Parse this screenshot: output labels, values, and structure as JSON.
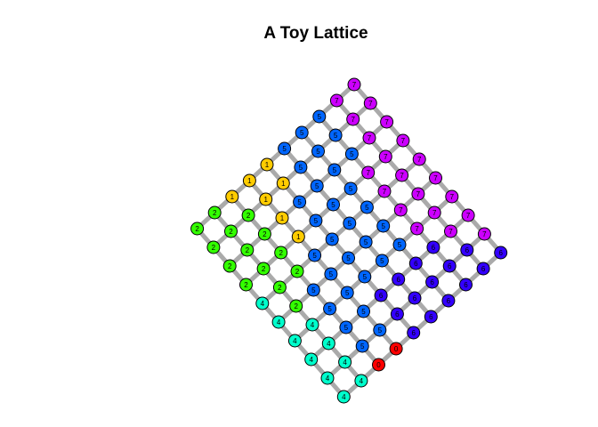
{
  "title": "A Toy Lattice",
  "colors": {
    "edge": "#aaaaaa",
    "node_stroke": "#000000",
    "groups": {
      "0": "#ff0000",
      "1": "#ffcc00",
      "2": "#33ff00",
      "3": "#00ff66",
      "4": "#00ffcc",
      "5": "#0066ff",
      "6": "#3300ff",
      "7": "#cc00ff"
    }
  },
  "lattice": {
    "rows": 10,
    "cols": 10,
    "groups": [
      [
        7,
        7,
        7,
        7,
        7,
        7,
        7,
        7,
        7,
        6
      ],
      [
        7,
        7,
        7,
        7,
        7,
        7,
        7,
        7,
        6,
        6
      ],
      [
        5,
        5,
        5,
        7,
        7,
        7,
        7,
        6,
        6,
        6
      ],
      [
        5,
        5,
        5,
        5,
        5,
        5,
        5,
        6,
        6,
        6
      ],
      [
        5,
        5,
        5,
        5,
        5,
        5,
        5,
        6,
        6,
        6
      ],
      [
        1,
        1,
        5,
        5,
        5,
        5,
        5,
        6,
        6,
        6
      ],
      [
        1,
        1,
        1,
        1,
        5,
        5,
        5,
        5,
        5,
        0
      ],
      [
        1,
        2,
        2,
        2,
        2,
        5,
        5,
        5,
        5,
        0
      ],
      [
        2,
        2,
        2,
        2,
        2,
        2,
        4,
        4,
        4,
        4
      ],
      [
        2,
        2,
        2,
        2,
        4,
        4,
        4,
        4,
        4,
        4
      ]
    ]
  }
}
